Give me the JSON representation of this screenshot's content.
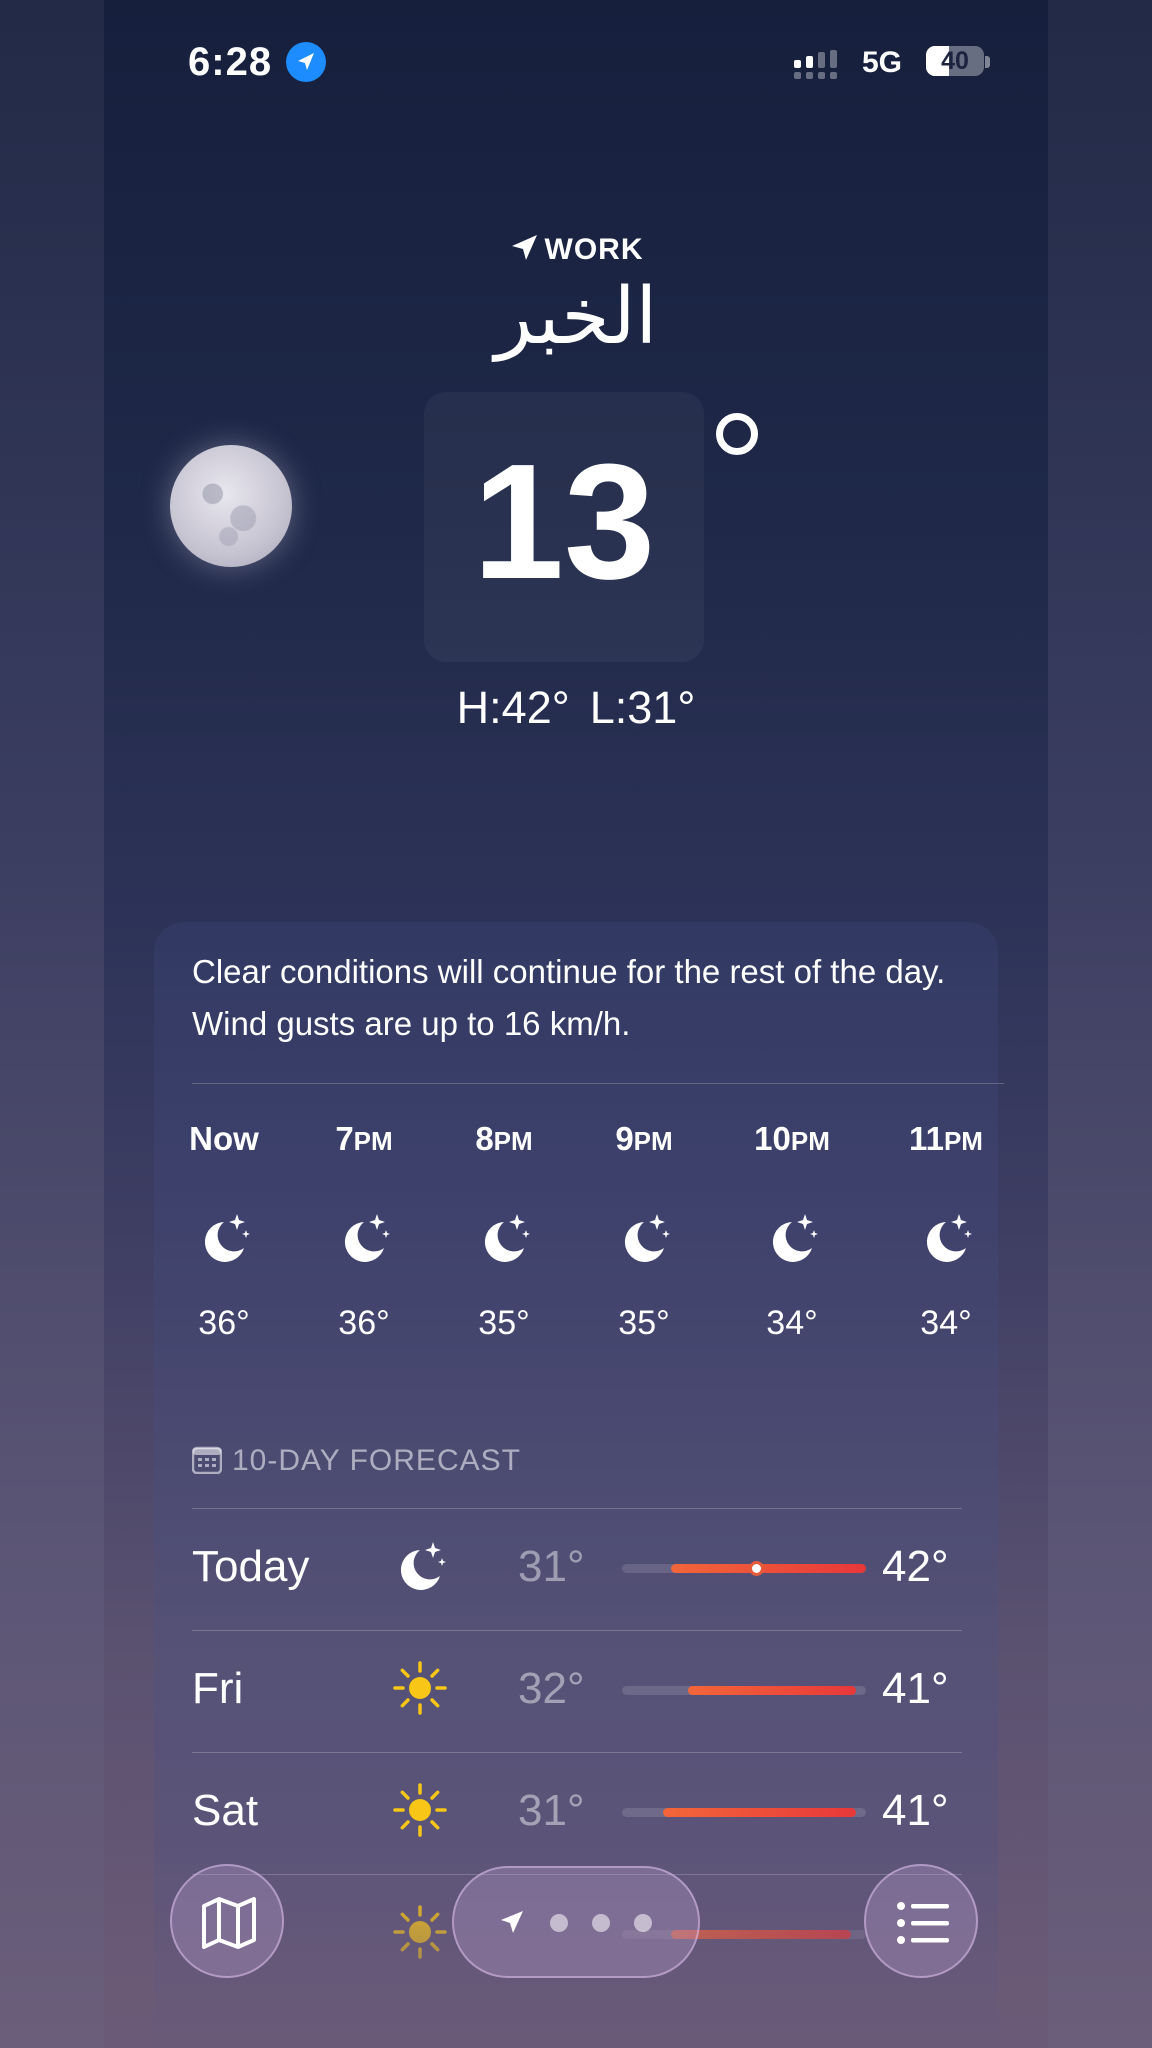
{
  "status_bar": {
    "time": "6:28",
    "network": "5G",
    "battery_level": "40",
    "battery_fraction": 0.4
  },
  "location": {
    "label": "WORK",
    "city": "الخبر"
  },
  "current": {
    "temperature": "13",
    "high_low": {
      "high": "H:42°",
      "low": "L:31°"
    }
  },
  "summary": "Clear conditions will continue for the rest of the day. Wind gusts are up to 16 km/h.",
  "hourly": [
    {
      "hour": "Now",
      "suffix": "",
      "icon": "moon-stars-icon",
      "temp": "36°"
    },
    {
      "hour": "7",
      "suffix": "PM",
      "icon": "moon-stars-icon",
      "temp": "36°"
    },
    {
      "hour": "8",
      "suffix": "PM",
      "icon": "moon-stars-icon",
      "temp": "35°"
    },
    {
      "hour": "9",
      "suffix": "PM",
      "icon": "moon-stars-icon",
      "temp": "35°"
    },
    {
      "hour": "10",
      "suffix": "PM",
      "icon": "moon-stars-icon",
      "temp": "34°"
    },
    {
      "hour": "11",
      "suffix": "PM",
      "icon": "moon-stars-icon",
      "temp": "34°"
    }
  ],
  "forecast": {
    "header": "10-DAY FORECAST",
    "days": [
      {
        "day": "Today",
        "icon": "moon-stars-icon",
        "low": "31°",
        "high": "42°",
        "range_start": 0.2,
        "range_end": 1.0,
        "current_marker": 0.55
      },
      {
        "day": "Fri",
        "icon": "sun-icon",
        "low": "32°",
        "high": "41°",
        "range_start": 0.27,
        "range_end": 0.96
      },
      {
        "day": "Sat",
        "icon": "sun-icon",
        "low": "31°",
        "high": "41°",
        "range_start": 0.17,
        "range_end": 0.96
      },
      {
        "day": "",
        "icon": "sun-icon",
        "low": "",
        "high": "",
        "range_start": 0.2,
        "range_end": 0.94
      }
    ]
  },
  "colors": {
    "accent_blue": "#1c8cff",
    "sun_yellow": "#f7c617",
    "bar_warm": "#f2663a",
    "bar_hot": "#e8383a"
  }
}
